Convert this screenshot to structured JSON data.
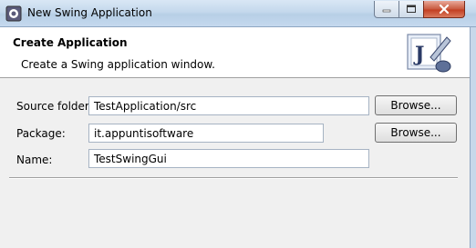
{
  "window": {
    "title": "New Swing Application",
    "controls": {
      "minimize": "minimize-icon",
      "maximize": "maximize-icon",
      "close": "close-icon"
    }
  },
  "banner": {
    "title": "Create Application",
    "description": "Create a Swing application window.",
    "icon": "java-swing-wizard-icon"
  },
  "form": {
    "source_folder": {
      "label": "Source folder:",
      "value": "TestApplication/src",
      "button": "Browse..."
    },
    "package": {
      "label": "Package:",
      "value": "it.appuntisoftware",
      "button": "Browse..."
    },
    "name": {
      "label": "Name:",
      "value": "TestSwingGui"
    }
  },
  "colors": {
    "titlebar": "#c4d8ec",
    "dialog_bg": "#f0f0f0",
    "banner_bg": "#ffffff",
    "close_button": "#c33f22"
  }
}
